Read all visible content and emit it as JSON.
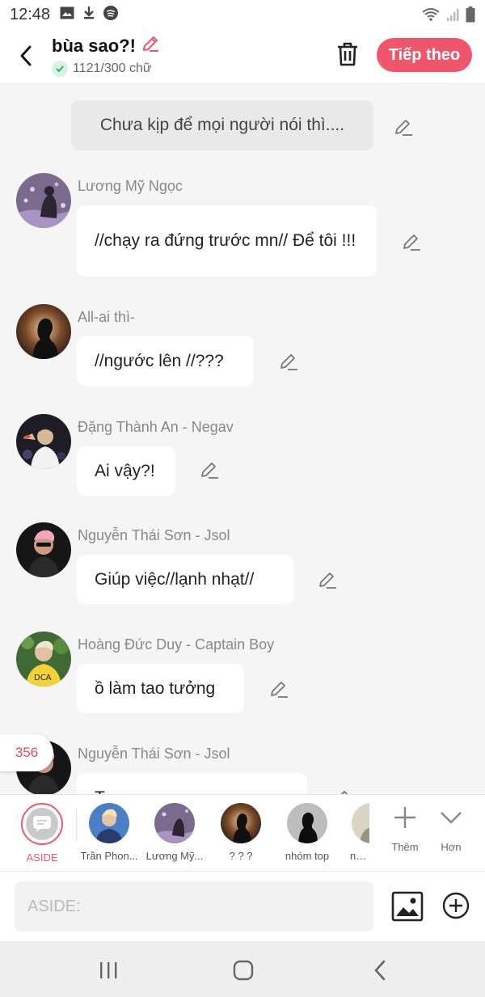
{
  "status": {
    "time": "12:48"
  },
  "header": {
    "title": "bùa sao?!",
    "word_count": "1121/300 chữ",
    "next_label": "Tiếp theo"
  },
  "narration": "Chưa kịp để mọi người nói thì....",
  "messages": [
    {
      "sender": "Lương Mỹ Ngọc",
      "text": "//chạy ra đứng trước mn// Để tôi !!!"
    },
    {
      "sender": "All-ai thì-",
      "text": "//ngước lên //???"
    },
    {
      "sender": "Đặng Thành An - Negav",
      "text": "Ai vậy?!"
    },
    {
      "sender": "Nguyễn Thái Sơn - Jsol",
      "text": "Giúp việc//lạnh nhạt//"
    },
    {
      "sender": "Hoàng Đức Duy - Captain Boy",
      "text": "ồ làm tao tưởng"
    },
    {
      "sender": "Nguyễn Thái Sơn - Jsol",
      "text": "T..."
    }
  ],
  "counter_badge": "356",
  "characters": [
    {
      "label": "ASIDE"
    },
    {
      "label": "Trần Phon..."
    },
    {
      "label": "Lương Mỹ..."
    },
    {
      "label": "? ? ?"
    },
    {
      "label": "nhóm top"
    },
    {
      "label": "nhó..."
    }
  ],
  "tools": {
    "more_label": "Thêm",
    "less_label": "Hơn"
  },
  "input": {
    "placeholder": "ASIDE:"
  },
  "colors": {
    "accent": "#f0566b",
    "background": "#f5f5f5",
    "bubble": "#ffffff",
    "narration_bg": "#e9e9e9"
  }
}
